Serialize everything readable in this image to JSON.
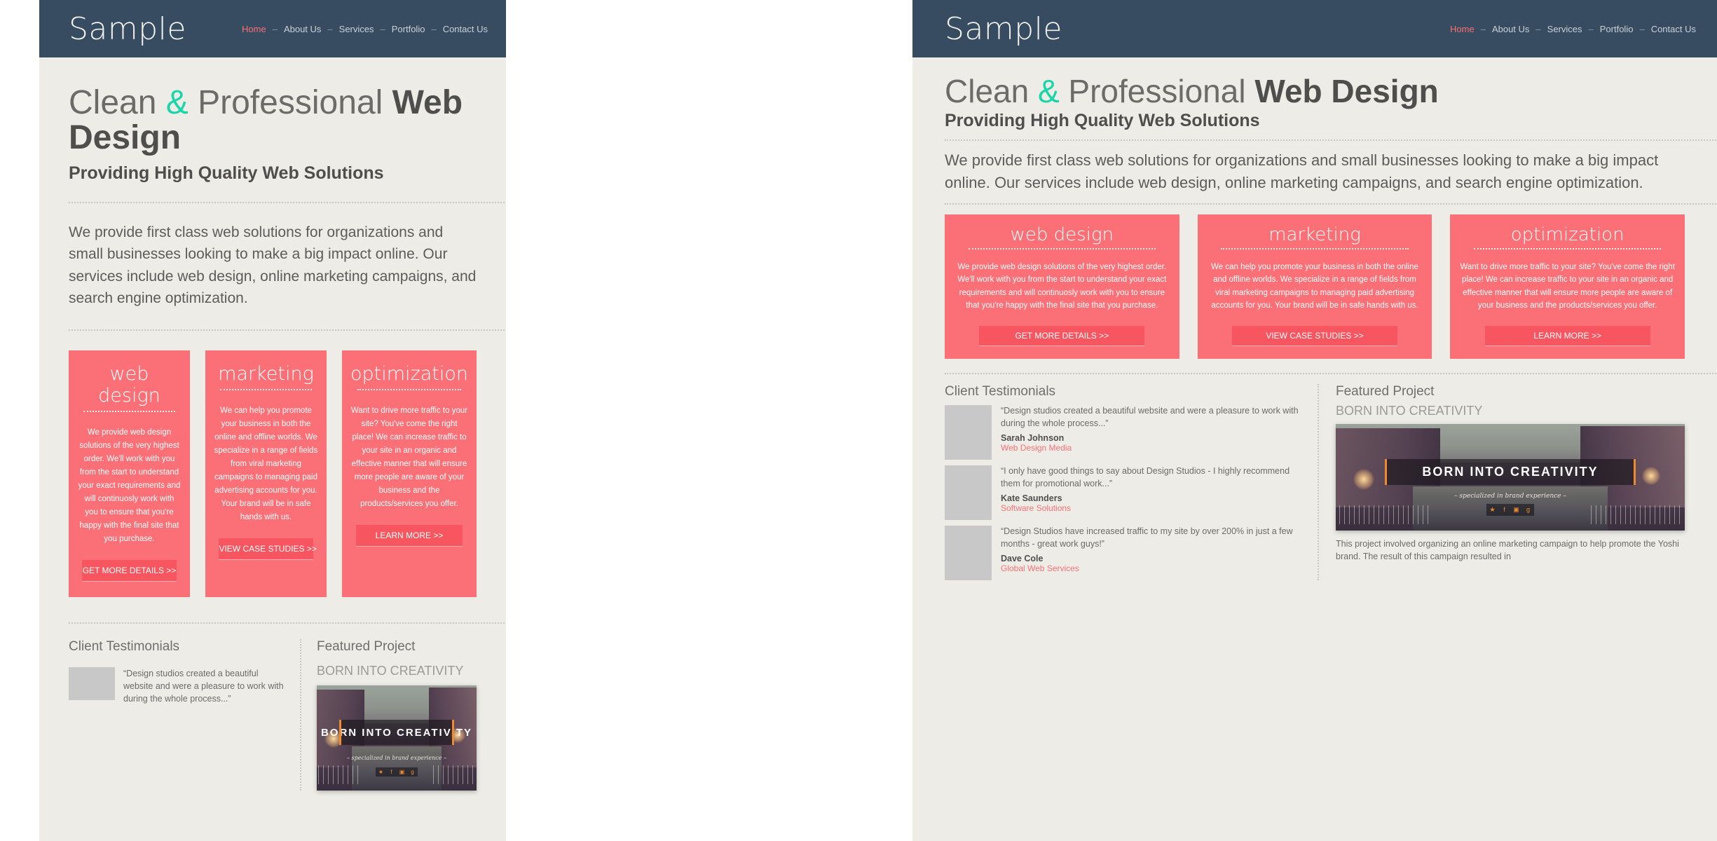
{
  "colors": {
    "header_bg": "#374c60",
    "page_bg": "#edece6",
    "accent_pink": "#fa7076",
    "accent_pink_dark": "#f7555f",
    "accent_teal": "#18d6a8",
    "text_dark": "#4e4e4c",
    "text_muted": "#6b6b68",
    "avatar_gray": "#c8c8c8",
    "canvas_white": "#ffffff"
  },
  "site": {
    "logo": "Sample",
    "nav": {
      "separator": "–",
      "items": [
        {
          "label": "Home",
          "active": true
        },
        {
          "label": "About Us",
          "active": false
        },
        {
          "label": "Services",
          "active": false
        },
        {
          "label": "Portfolio",
          "active": false
        },
        {
          "label": "Contact Us",
          "active": false
        }
      ]
    },
    "hero": {
      "part1": "Clean ",
      "amp": "&",
      "part2": " Professional ",
      "part3": "Web Design",
      "subtitle": "Providing High Quality Web Solutions"
    },
    "lede": "We provide first class web solutions for organizations and small businesses looking to make a big impact online. Our services include web design, online marketing campaigns, and search engine optimization.",
    "cards": [
      {
        "title": "web design",
        "body": "We provide web design solutions of the very highest order. We'll work with you from the start to understand your exact requirements and will continuosly work with you to ensure that you're happy with the final site that you purchase.",
        "button": "GET MORE DETAILS >>"
      },
      {
        "title": "marketing",
        "body": "We can help you promote your business in both the online and offline worlds. We specialize in a range of fields from viral marketing campaigns to managing paid advertising accounts for you. Your brand will be in safe hands with us.",
        "button": "VIEW CASE STUDIES >>"
      },
      {
        "title": "optimization",
        "body": "Want to drive more traffic to your site? You've come the right place! We can increase traffic to your site in an organic and effective manner that will ensure more people are aware of your business and the products/services you offer.",
        "button": "LEARN MORE >>"
      }
    ],
    "testimonials": {
      "heading": "Client Testimonials",
      "items": [
        {
          "quote": "“Design studios created a beautiful website and were a pleasure to work with during the whole process...”",
          "name": "Sarah Johnson",
          "company": "Web Design Media"
        },
        {
          "quote": "“I only have good things to say about Design Studios - I highly recommend them for promotional work...”",
          "name": "Kate Saunders",
          "company": "Software Solutions"
        },
        {
          "quote": "“Design Studios have increased traffic to my site by over 200% in just a few months - great work guys!”",
          "name": "Dave Cole",
          "company": "Global Web Services"
        }
      ]
    },
    "featured": {
      "heading": "Featured Project",
      "subheading": "BORN INTO CREATIVITY",
      "image_title": "BORN INTO CREATIVITY",
      "image_tagline": "– specialized in brand experience –",
      "social_icons": [
        "twitter-icon",
        "facebook-icon",
        "instagram-icon",
        "google-plus-icon"
      ],
      "description": "This project involved organizing an online marketing campaign to help promote the Yoshi brand. The result of this campaign resulted in"
    }
  }
}
